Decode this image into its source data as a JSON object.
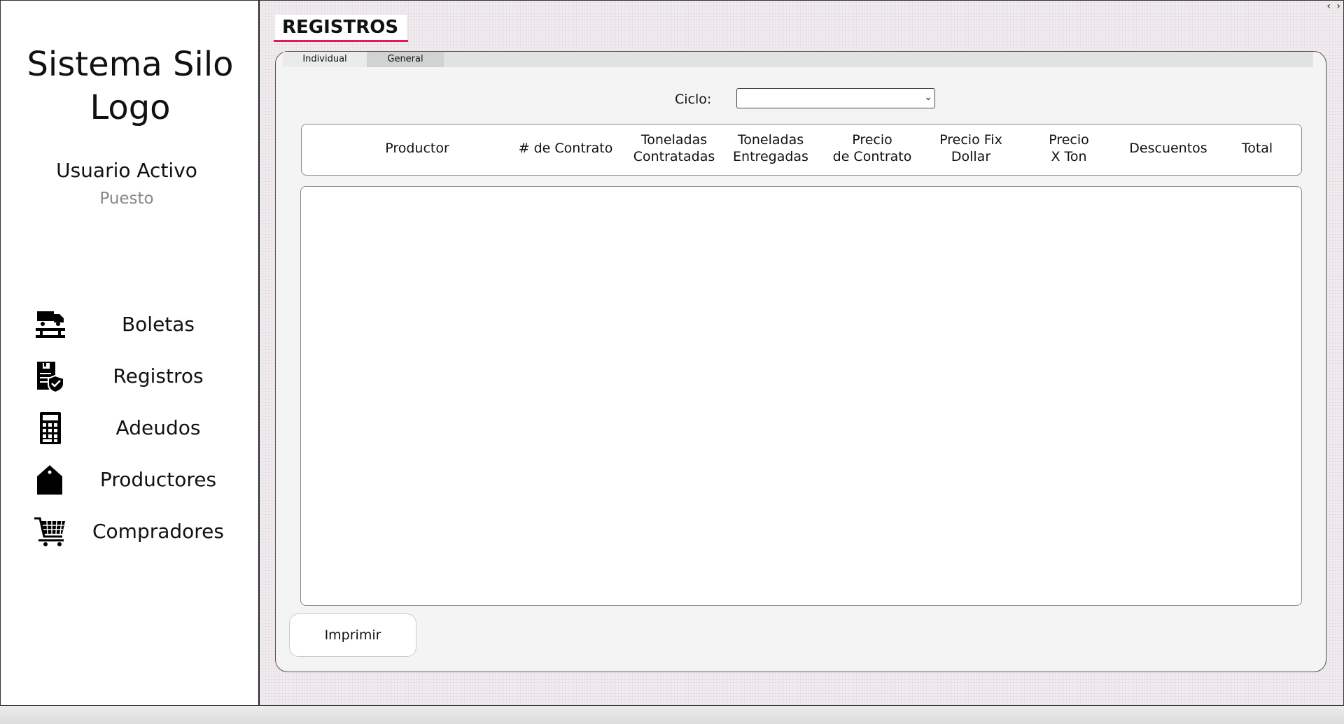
{
  "sidebar": {
    "app_title": "Sistema Silo\nLogo",
    "user_name": "Usuario Activo",
    "user_role": "Puesto",
    "nav": [
      {
        "label": "Boletas",
        "icon": "truck-scale-icon"
      },
      {
        "label": "Registros",
        "icon": "document-shield-icon"
      },
      {
        "label": "Adeudos",
        "icon": "calculator-icon"
      },
      {
        "label": "Productores",
        "icon": "house-tag-icon"
      },
      {
        "label": "Compradores",
        "icon": "shopping-cart-icon"
      }
    ]
  },
  "page": {
    "title": "REGISTROS",
    "accent_color": "#e21a5a",
    "tabs": [
      {
        "label": "Individual",
        "state": "inactive"
      },
      {
        "label": "General",
        "state": "active"
      }
    ],
    "ciclo_label": "Ciclo:",
    "ciclo_value": "",
    "columns": [
      "Productor",
      "# de Contrato",
      "Toneladas\nContratadas",
      "Toneladas\nEntregadas",
      "Precio\nde Contrato",
      "Precio Fix\nDollar",
      "Precio\nX Ton",
      "Descuentos",
      "Total"
    ],
    "rows": [],
    "print_label": "Imprimir"
  },
  "window": {
    "corner_arrows": "‹ ›"
  }
}
